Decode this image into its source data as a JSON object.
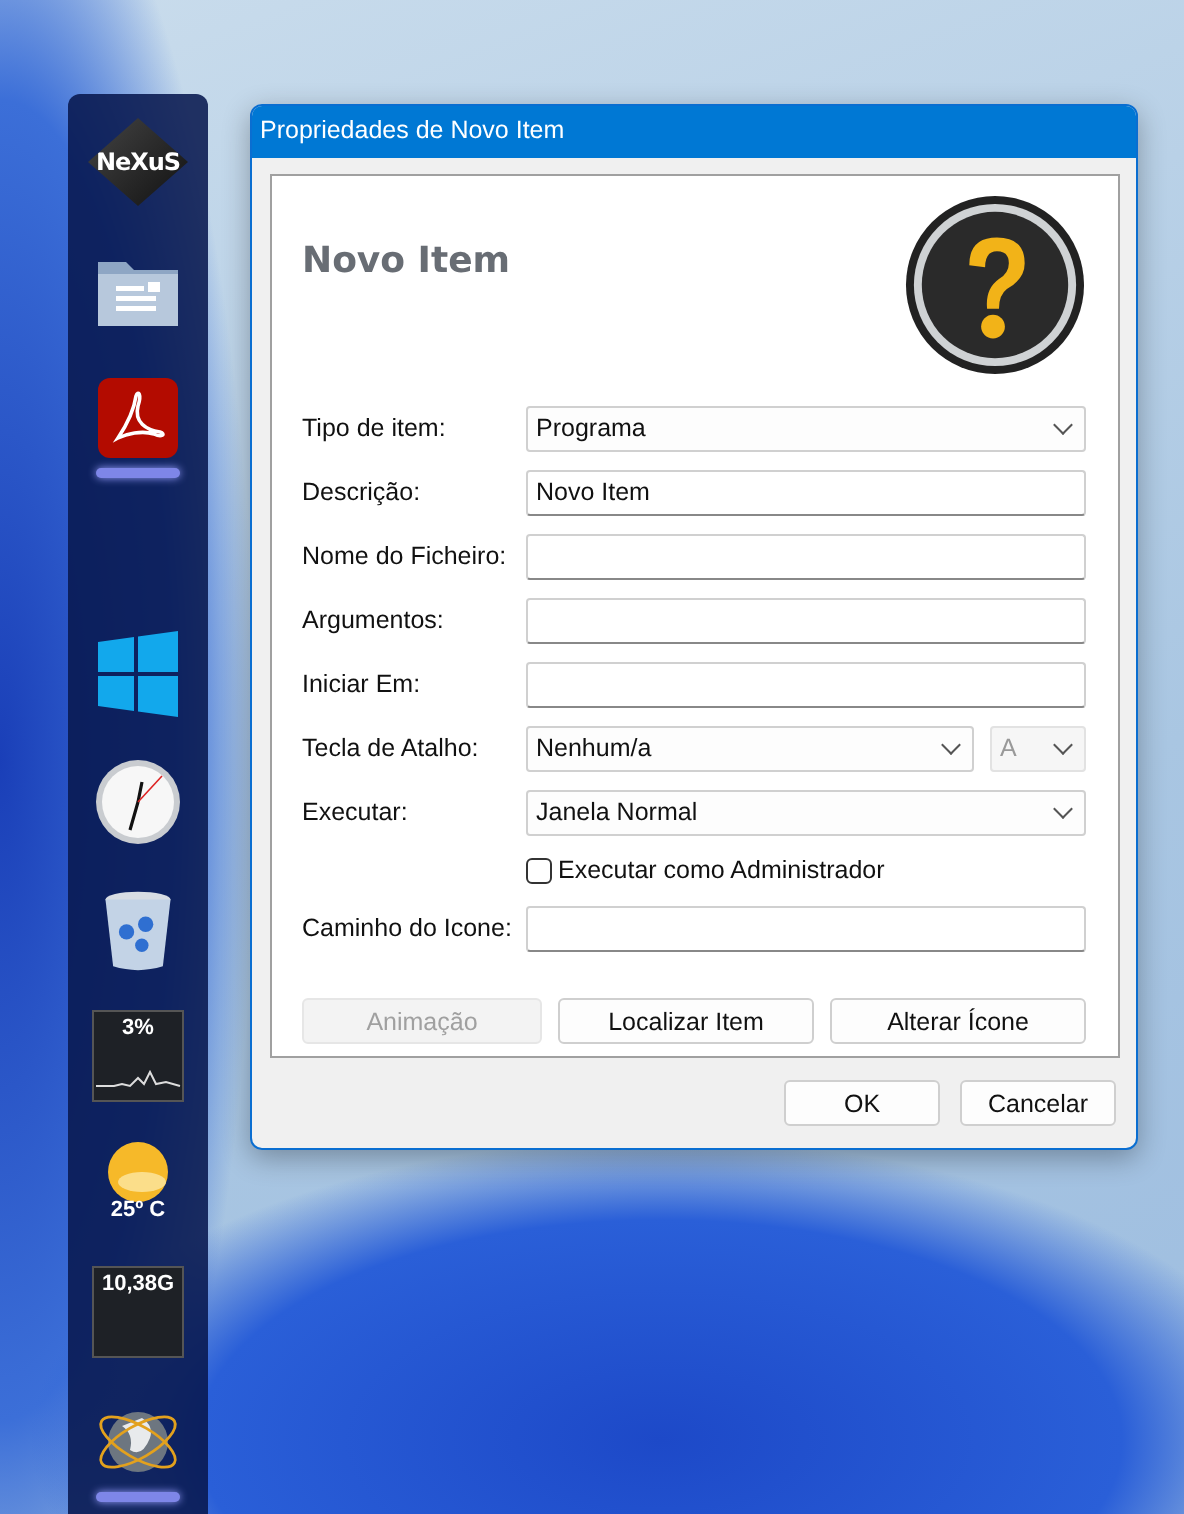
{
  "dock": {
    "items": [
      {
        "kind": "logo",
        "label": "NeXuS",
        "running": false
      },
      {
        "kind": "folder",
        "running": false
      },
      {
        "kind": "pdf",
        "running": true
      },
      {
        "kind": "empty",
        "running": false
      },
      {
        "kind": "windows",
        "running": false
      },
      {
        "kind": "clock",
        "running": false
      },
      {
        "kind": "bin",
        "running": false
      },
      {
        "kind": "cpu",
        "label": "3%",
        "running": false
      },
      {
        "kind": "weather",
        "label": "25º C",
        "running": false
      },
      {
        "kind": "disk",
        "label": "10,38G",
        "running": false
      },
      {
        "kind": "globe",
        "running": true
      }
    ]
  },
  "window": {
    "title": "Propriedades de Novo Item"
  },
  "header": {
    "title": "Novo Item"
  },
  "fields": [
    {
      "kind": "select",
      "label": "Tipo de item:",
      "value": "Programa"
    },
    {
      "kind": "text",
      "label": "Descrição:",
      "value": "Novo Item"
    },
    {
      "kind": "text",
      "label": "Nome do Ficheiro:"
    },
    {
      "kind": "text",
      "label": "Argumentos:"
    },
    {
      "kind": "text",
      "label": "Iniciar Em:"
    },
    {
      "kind": "select",
      "label": "Tecla de Atalho:",
      "value": "Nenhum/a",
      "secondary": {
        "value": "A",
        "disabled": true
      }
    },
    {
      "kind": "select",
      "label": "Executar:",
      "value": "Janela Normal"
    },
    {
      "kind": "checkbox",
      "label": "Executar como Administrador",
      "checked": false
    },
    {
      "kind": "text",
      "label": "Caminho do Icone:"
    }
  ],
  "actions": [
    {
      "label": "Animação",
      "disabled": true
    },
    {
      "label": "Localizar Item",
      "disabled": false
    },
    {
      "label": "Alterar Ícone",
      "disabled": false
    }
  ],
  "footer_buttons": [
    "OK",
    "Cancelar"
  ]
}
